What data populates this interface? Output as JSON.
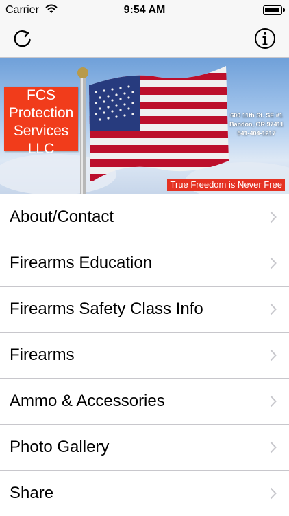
{
  "status_bar": {
    "carrier": "Carrier",
    "time": "9:54 AM",
    "wifi_icon": "wifi-icon",
    "battery_icon": "battery-icon"
  },
  "nav_bar": {
    "left_icon": "refresh-icon",
    "right_icon": "info-icon"
  },
  "banner": {
    "badge_lines": [
      "FCS",
      "Protection",
      "Services",
      "LLC"
    ],
    "address_lines": [
      "600 11th St. SE #1",
      "Bandon, OR 97411",
      "541-404-1217"
    ],
    "tagline": "True Freedom is Never Free",
    "colors": {
      "badge": "#f13c1b",
      "tagline_bg": "#e53222",
      "sky": "#6fa0d9"
    }
  },
  "menu": {
    "items": [
      {
        "label": "About/Contact"
      },
      {
        "label": "Firearms Education"
      },
      {
        "label": "Firearms Safety Class Info"
      },
      {
        "label": "Firearms"
      },
      {
        "label": "Ammo & Accessories"
      },
      {
        "label": "Photo Gallery"
      },
      {
        "label": "Share"
      }
    ],
    "chevron_icon": "chevron-right-icon"
  }
}
